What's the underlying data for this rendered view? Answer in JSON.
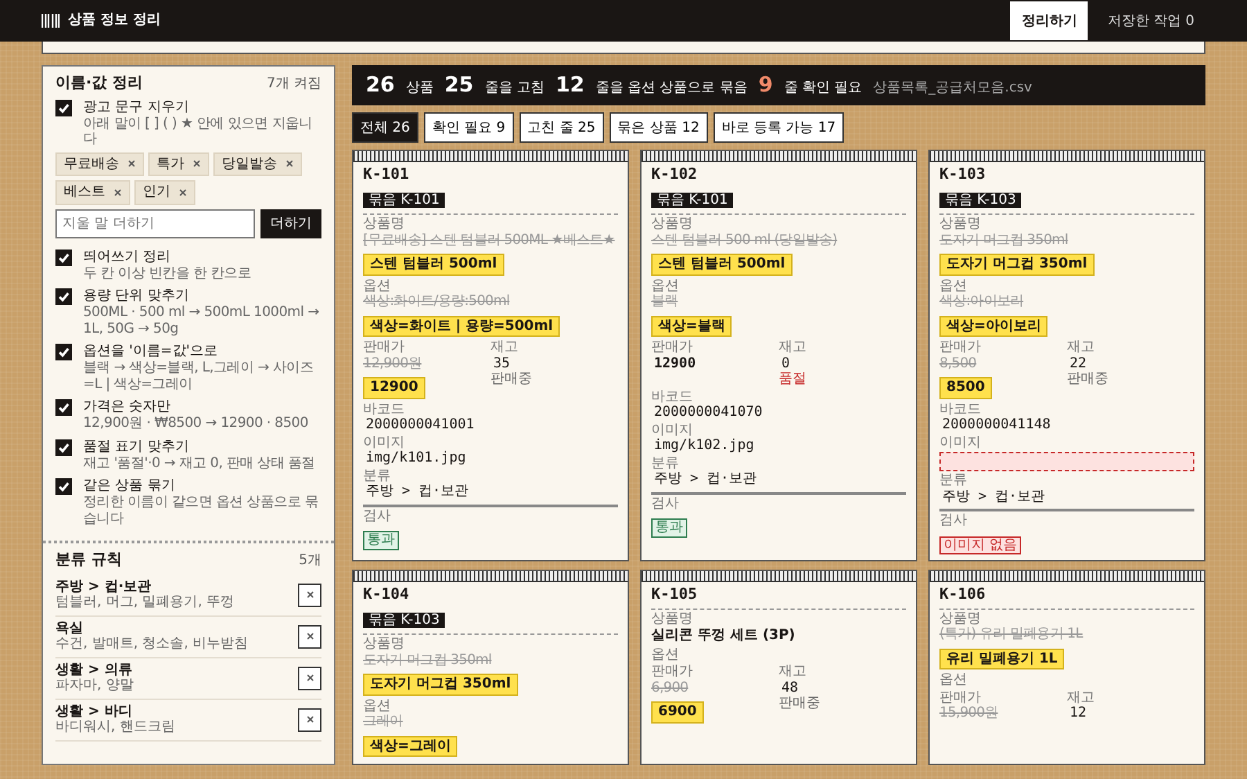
{
  "top_bar": {
    "title": "상품 정보 정리",
    "tabs": [
      {
        "label": "정리하기",
        "selected": true
      },
      {
        "label": "저장한 작업 0",
        "selected": false
      }
    ]
  },
  "sidebar": {
    "clean": {
      "title": "이름·값 정리",
      "count": "7개 켜짐",
      "rules": [
        {
          "title": "광고 문구 지우기",
          "desc": "아래 말이 [ ] ( ) ★ 안에 있으면 지웁니다",
          "checked": true,
          "tags": [
            "무료배송",
            "특가",
            "당일발송",
            "베스트",
            "인기"
          ],
          "input": {
            "placeholder": "지울 말 더하기",
            "button": "더하기"
          }
        },
        {
          "title": "띄어쓰기 정리",
          "desc": "두 칸 이상 빈칸을 한 칸으로",
          "checked": true
        },
        {
          "title": "용량 단위 맞추기",
          "desc": "500ML · 500 ml → 500mL 1000ml → 1L, 50G → 50g",
          "checked": true
        },
        {
          "title": "옵션을 '이름=값'으로",
          "desc": "블랙 → 색상=블랙, L,그레이 → 사이즈=L | 색상=그레이",
          "checked": true
        },
        {
          "title": "가격은 숫자만",
          "desc": "12,900원 · ₩8500 → 12900 · 8500",
          "checked": true
        },
        {
          "title": "품절 표기 맞추기",
          "desc": "재고 '품절'·0 → 재고 0, 판매 상태 품절",
          "checked": true
        },
        {
          "title": "같은 상품 묶기",
          "desc": "정리한 이름이 같으면 옵션 상품으로 묶습니다",
          "checked": true
        }
      ]
    },
    "categories": {
      "title": "분류 규칙",
      "count": "5개",
      "rules": [
        {
          "title": "주방 > 컵·보관",
          "desc": "텀블러, 머그, 밀폐용기, 뚜껑"
        },
        {
          "title": "욕실",
          "desc": "수건, 발매트, 청소솔, 비누받침"
        },
        {
          "title": "생활 > 의류",
          "desc": "파자마, 양말"
        },
        {
          "title": "생활 > 바디",
          "desc": "바디워시, 핸드크림"
        }
      ]
    }
  },
  "stats": {
    "items": [
      {
        "number": "26",
        "label": "상품",
        "alert": false
      },
      {
        "number": "25",
        "label": "줄을 고침",
        "alert": false
      },
      {
        "number": "12",
        "label": "줄을 옵션 상품으로 묶음",
        "alert": false
      },
      {
        "number": "9",
        "label": "줄 확인 필요",
        "alert": true
      }
    ],
    "file": "상품목록_공급처모음.csv"
  },
  "filters": [
    {
      "label": "전체 26",
      "selected": true
    },
    {
      "label": "확인 필요 9",
      "selected": false
    },
    {
      "label": "고친 줄 25",
      "selected": false
    },
    {
      "label": "묶은 상품 12",
      "selected": false
    },
    {
      "label": "바로 등록 가능 17",
      "selected": false
    }
  ],
  "cards": [
    {
      "id": "K-101",
      "group": "묶음 K-101",
      "fields": [
        {
          "kind": "name",
          "label": "상품명",
          "original": "[무료배송] 스텐 텀블러 500ML ★베스트★",
          "value": "스텐 텀블러 500ml",
          "changed": true
        },
        {
          "kind": "option",
          "label": "옵션",
          "original": "색상:화이트/용량:500ml",
          "value": "색상=화이트 | 용량=500ml",
          "changed": true
        },
        {
          "kind": "price",
          "label": "판매가",
          "original": "12,900원",
          "value": "12900",
          "changed": true,
          "stock_label": "재고",
          "stock": "35",
          "stock_status": "판매중",
          "sold_out": false
        },
        {
          "kind": "mono",
          "label": "바코드",
          "value": "2000000041001"
        },
        {
          "kind": "image",
          "label": "이미지",
          "value": "img/k101.jpg",
          "missing": false
        },
        {
          "kind": "mono",
          "label": "분류",
          "value": "주방 > 컵·보관"
        },
        {
          "kind": "check",
          "label": "검사",
          "value": "통과",
          "passed": true
        }
      ]
    },
    {
      "id": "K-102",
      "group": "묶음 K-101",
      "fields": [
        {
          "kind": "name",
          "label": "상품명",
          "original": "스텐 텀블러 500 ml (당일발송)",
          "value": "스텐 텀블러 500ml",
          "changed": true
        },
        {
          "kind": "option",
          "label": "옵션",
          "original": "블랙",
          "value": "색상=블랙",
          "changed": true
        },
        {
          "kind": "price",
          "label": "판매가",
          "value": "12900",
          "changed": false,
          "stock_label": "재고",
          "stock": "0",
          "stock_status": "품절",
          "sold_out": true
        },
        {
          "kind": "mono",
          "label": "바코드",
          "value": "2000000041070"
        },
        {
          "kind": "image",
          "label": "이미지",
          "value": "img/k102.jpg",
          "missing": false
        },
        {
          "kind": "mono",
          "label": "분류",
          "value": "주방 > 컵·보관"
        },
        {
          "kind": "check",
          "label": "검사",
          "value": "통과",
          "passed": true
        }
      ]
    },
    {
      "id": "K-103",
      "group": "묶음 K-103",
      "fields": [
        {
          "kind": "name",
          "label": "상품명",
          "original": "도자기 머그컵 350ml",
          "value": "도자기 머그컵 350ml",
          "changed": true
        },
        {
          "kind": "option",
          "label": "옵션",
          "original": "색상:아이보리",
          "value": "색상=아이보리",
          "changed": true
        },
        {
          "kind": "price",
          "label": "판매가",
          "original": "8,500",
          "value": "8500",
          "changed": true,
          "stock_label": "재고",
          "stock": "22",
          "stock_status": "판매중",
          "sold_out": false
        },
        {
          "kind": "mono",
          "label": "바코드",
          "value": "2000000041148"
        },
        {
          "kind": "image",
          "label": "이미지",
          "missing": true
        },
        {
          "kind": "mono",
          "label": "분류",
          "value": "주방 > 컵·보관"
        },
        {
          "kind": "check",
          "label": "검사",
          "value": "이미지 없음",
          "passed": false
        }
      ]
    },
    {
      "id": "K-104",
      "group": "묶음 K-103",
      "fields": [
        {
          "kind": "name",
          "label": "상품명",
          "original": "도자기 머그컵 350ml",
          "value": "도자기 머그컵 350ml",
          "changed": true
        },
        {
          "kind": "option",
          "label": "옵션",
          "original": "그레이",
          "value": "색상=그레이",
          "changed": true
        }
      ]
    },
    {
      "id": "K-105",
      "fields": [
        {
          "kind": "name",
          "label": "상품명",
          "value": "실리콘 뚜껑 세트 (3P)",
          "changed": false
        },
        {
          "kind": "option",
          "label": "옵션"
        },
        {
          "kind": "price",
          "label": "판매가",
          "original": "6,900",
          "value": "6900",
          "changed": true,
          "stock_label": "재고",
          "stock": "48",
          "stock_status": "판매중",
          "sold_out": false
        }
      ]
    },
    {
      "id": "K-106",
      "fields": [
        {
          "kind": "name",
          "label": "상품명",
          "original": "(특가) 유리 밀폐용기 1L",
          "value": "유리 밀폐용기 1L",
          "changed": true
        },
        {
          "kind": "option",
          "label": "옵션"
        },
        {
          "kind": "price",
          "label": "판매가",
          "original": "15,900원",
          "stock_label": "재고",
          "stock": "12"
        }
      ]
    }
  ]
}
